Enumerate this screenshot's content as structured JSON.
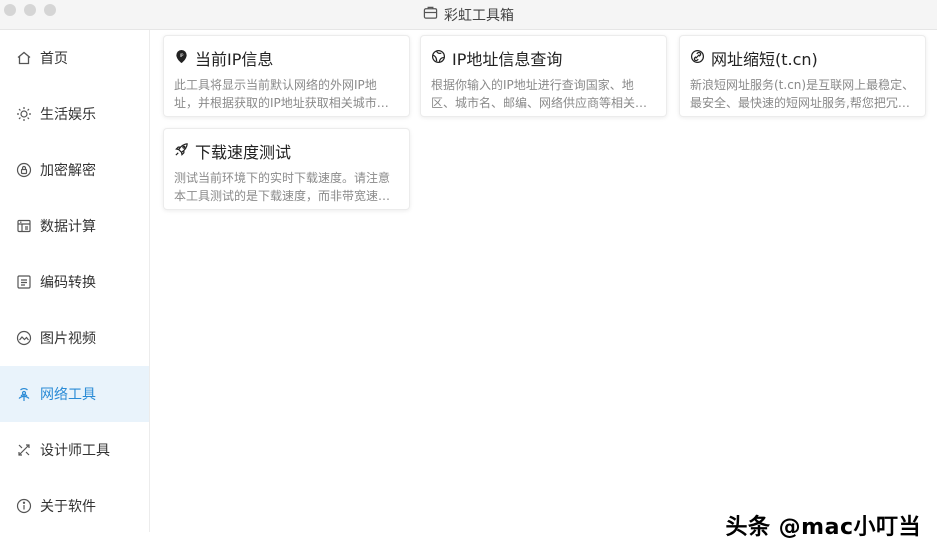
{
  "window": {
    "title": "彩虹工具箱"
  },
  "sidebar": {
    "items": [
      {
        "label": "首页",
        "icon": "home-icon",
        "active": false
      },
      {
        "label": "生活娱乐",
        "icon": "sun-icon",
        "active": false
      },
      {
        "label": "加密解密",
        "icon": "lock-icon",
        "active": false
      },
      {
        "label": "数据计算",
        "icon": "calculator-icon",
        "active": false
      },
      {
        "label": "编码转换",
        "icon": "code-icon",
        "active": false
      },
      {
        "label": "图片视频",
        "icon": "image-icon",
        "active": false
      },
      {
        "label": "网络工具",
        "icon": "network-icon",
        "active": true
      },
      {
        "label": "设计师工具",
        "icon": "design-icon",
        "active": false
      },
      {
        "label": "关于软件",
        "icon": "info-icon",
        "active": false
      }
    ],
    "accent": "#2a8bd6"
  },
  "cards": [
    {
      "title": "当前IP信息",
      "icon": "ip-pin-icon",
      "desc": "此工具将显示当前默认网络的外网IP地址，并根据获取的IP地址获取相关城市…"
    },
    {
      "title": "IP地址信息查询",
      "icon": "globe-icon",
      "desc": "根据你输入的IP地址进行查询国家、地区、城市名、邮编、网络供应商等相关…"
    },
    {
      "title": "网址缩短(t.cn)",
      "icon": "link-icon",
      "desc": "新浪短网址服务(t.cn)是互联网上最稳定、最安全、最快速的短网址服务,帮您把冗…"
    },
    {
      "title": "下载速度测试",
      "icon": "rocket-icon",
      "desc": "测试当前环境下的实时下载速度。请注意本工具测试的是下载速度，而非带宽速…"
    }
  ],
  "watermark": "头条 @mac小叮当"
}
